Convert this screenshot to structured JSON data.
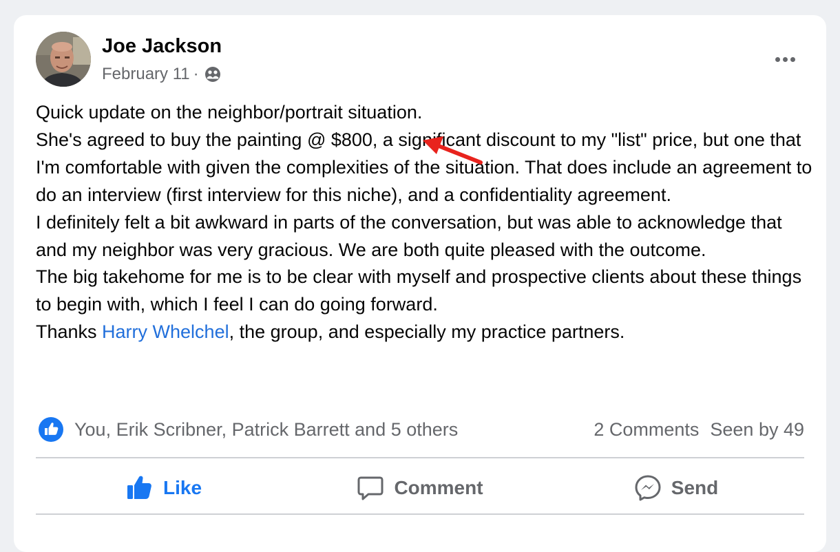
{
  "post": {
    "author": "Joe Jackson",
    "date": "February 11",
    "separator": "·",
    "audience_icon": "friends-icon",
    "more_icon": "more-options-icon",
    "paragraphs": [
      "Quick update on the neighbor/portrait situation.",
      "She's agreed to buy the painting @ $800, a significant discount to my \"list\" price, but one that I'm comfortable with given the complexities of the situation.  That does include an agreement to do an interview (first interview for this niche), and a confidentiality agreement.",
      "I definitely felt a bit awkward in parts of the conversation, but was able to acknowledge that and my neighbor was very gracious.  We are both quite pleased with the outcome.",
      "The big takehome for me is to be clear with myself and  prospective clients about these things to begin with, which I feel I can do going forward."
    ],
    "thanks_prefix": "Thanks ",
    "mention": "Harry Whelchel",
    "thanks_suffix": ", the group, and especially my practice partners."
  },
  "reactions": {
    "icon": "like-reaction-icon",
    "summary": "You, Erik Scribner, Patrick Barrett and 5 others",
    "comments": "2 Comments",
    "seen": "Seen by 49"
  },
  "actions": {
    "like": "Like",
    "comment": "Comment",
    "send": "Send"
  },
  "annotation": {
    "arrow_color": "#e8231d"
  },
  "colors": {
    "accent": "#1877f2",
    "mention": "#216fdb",
    "muted": "#65676b"
  }
}
